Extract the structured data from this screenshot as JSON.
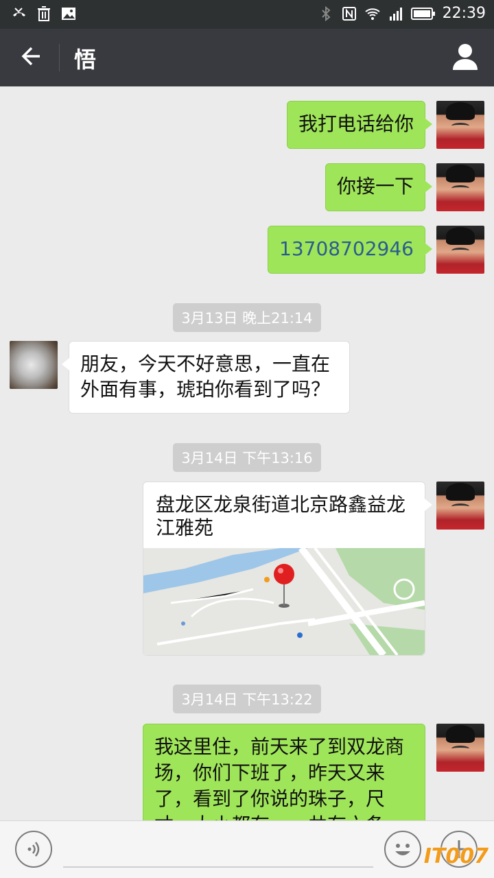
{
  "status_bar": {
    "time": "22:39",
    "left_icons": [
      "missed-call-icon",
      "trash-icon",
      "image-icon"
    ],
    "right_icons": [
      "bluetooth-icon",
      "nfc-icon",
      "wifi-icon",
      "signal-icon",
      "battery-icon"
    ]
  },
  "header": {
    "title": "悟",
    "back_icon": "arrow-left-icon",
    "profile_icon": "person-icon"
  },
  "messages": [
    {
      "sender": "me",
      "type": "text",
      "text": "我打电话给你"
    },
    {
      "sender": "me",
      "type": "text",
      "text": "你接一下"
    },
    {
      "sender": "me",
      "type": "text",
      "text": "13708702946"
    },
    {
      "type": "timestamp",
      "text": "3月13日 晚上21:14"
    },
    {
      "sender": "other",
      "type": "text",
      "text": "朋友，今天不好意思，一直在外面有事，琥珀你看到了吗？",
      "lines": [
        "朋友，今天不好意思，一直在",
        "外面有事，琥珀你看到了吗？"
      ]
    },
    {
      "type": "timestamp",
      "text": "3月14日 下午13:16"
    },
    {
      "sender": "me",
      "type": "location",
      "text": "盘龙区龙泉街道北京路鑫益龙江雅苑",
      "lines": [
        "盘龙区龙泉街道北京路鑫益龙",
        "江雅苑"
      ]
    },
    {
      "type": "timestamp",
      "text": "3月14日 下午13:22"
    },
    {
      "sender": "me",
      "type": "text",
      "lines": [
        "我这里住，前天来了到双龙商",
        "场，你们下班了，昨天又来",
        "了，看到了你说的珠子，尺",
        "寸、大小都有……共有六条"
      ]
    }
  ],
  "input_bar": {
    "voice_icon": "voice-icon",
    "emoji_icon": "smiley-icon",
    "plus_icon": "plus-icon"
  },
  "watermark": "IT007",
  "colors": {
    "header_bg": "#393a3f",
    "status_bg": "#2e3132",
    "chat_bg": "#ebebeb",
    "bubble_me": "#9fe559",
    "bubble_other": "#ffffff",
    "timestamp_bg": "#cecece",
    "watermark": "#f39b1b"
  }
}
